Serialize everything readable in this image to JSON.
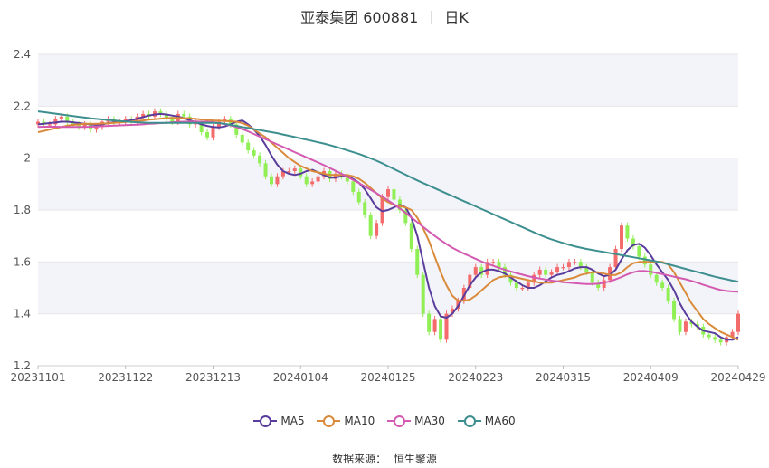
{
  "title": {
    "stock": "亚泰集团 600881",
    "period": "日K"
  },
  "source": {
    "label": "数据来源：",
    "name": "恒生聚源"
  },
  "colors": {
    "up": "#f36b6b",
    "down": "#90ef55",
    "MA5": "#5a3c9c",
    "MA10": "#d98a3a",
    "MA30": "#d35ab0",
    "MA60": "#3d8f8f",
    "band": "#f3f4fa",
    "grid": "#e6e6e6"
  },
  "chart_data": {
    "type": "candlestick",
    "ylim": [
      1.2,
      2.4
    ],
    "yticks": [
      "1.2",
      "1.4",
      "1.6",
      "1.8",
      "2",
      "2.2",
      "2.4"
    ],
    "xtick_labels": [
      "20231101",
      "20231122",
      "20231213",
      "20240104",
      "20240125",
      "20240223",
      "20240315",
      "20240409",
      "20240429"
    ],
    "xtick_index": [
      0,
      15,
      30,
      45,
      60,
      75,
      90,
      105,
      120
    ],
    "close": [
      2.14,
      2.13,
      2.13,
      2.15,
      2.16,
      2.14,
      2.13,
      2.12,
      2.13,
      2.11,
      2.12,
      2.14,
      2.15,
      2.14,
      2.14,
      2.15,
      2.14,
      2.16,
      2.17,
      2.16,
      2.18,
      2.17,
      2.15,
      2.14,
      2.17,
      2.16,
      2.13,
      2.14,
      2.1,
      2.08,
      2.12,
      2.14,
      2.15,
      2.13,
      2.09,
      2.06,
      2.03,
      2.01,
      1.98,
      1.93,
      1.9,
      1.93,
      1.95,
      1.95,
      1.96,
      1.93,
      1.9,
      1.91,
      1.93,
      1.95,
      1.92,
      1.94,
      1.93,
      1.91,
      1.87,
      1.83,
      1.78,
      1.7,
      1.75,
      1.85,
      1.88,
      1.84,
      1.8,
      1.75,
      1.65,
      1.55,
      1.4,
      1.33,
      1.38,
      1.3,
      1.4,
      1.42,
      1.45,
      1.5,
      1.55,
      1.58,
      1.55,
      1.6,
      1.6,
      1.58,
      1.55,
      1.52,
      1.5,
      1.5,
      1.52,
      1.55,
      1.57,
      1.55,
      1.56,
      1.58,
      1.58,
      1.6,
      1.6,
      1.58,
      1.56,
      1.52,
      1.5,
      1.53,
      1.58,
      1.65,
      1.74,
      1.69,
      1.66,
      1.62,
      1.59,
      1.55,
      1.52,
      1.5,
      1.45,
      1.38,
      1.33,
      1.37,
      1.36,
      1.35,
      1.32,
      1.31,
      1.3,
      1.29,
      1.31,
      1.33,
      1.4
    ],
    "series": [
      {
        "name": "MA5",
        "values": [
          2.13,
          2.132,
          2.135,
          2.137,
          2.14,
          2.14,
          2.138,
          2.135,
          2.132,
          2.13,
          2.128,
          2.13,
          2.135,
          2.138,
          2.14,
          2.142,
          2.146,
          2.152,
          2.158,
          2.164,
          2.168,
          2.17,
          2.168,
          2.164,
          2.16,
          2.154,
          2.146,
          2.138,
          2.13,
          2.124,
          2.12,
          2.118,
          2.122,
          2.13,
          2.14,
          2.145,
          2.13,
          2.11,
          2.085,
          2.05,
          2.01,
          1.975,
          1.95,
          1.94,
          1.935,
          1.94,
          1.95,
          1.955,
          1.945,
          1.935,
          1.925,
          1.925,
          1.93,
          1.93,
          1.92,
          1.905,
          1.88,
          1.845,
          1.81,
          1.795,
          1.8,
          1.81,
          1.82,
          1.81,
          1.77,
          1.7,
          1.6,
          1.5,
          1.43,
          1.39,
          1.385,
          1.4,
          1.43,
          1.47,
          1.51,
          1.54,
          1.56,
          1.57,
          1.57,
          1.565,
          1.555,
          1.54,
          1.525,
          1.51,
          1.5,
          1.5,
          1.51,
          1.525,
          1.54,
          1.55,
          1.555,
          1.565,
          1.575,
          1.58,
          1.58,
          1.57,
          1.555,
          1.545,
          1.55,
          1.57,
          1.61,
          1.645,
          1.665,
          1.67,
          1.655,
          1.625,
          1.59,
          1.56,
          1.53,
          1.49,
          1.44,
          1.4,
          1.37,
          1.35,
          1.335,
          1.33,
          1.325,
          1.31,
          1.3,
          1.3,
          1.31
        ]
      },
      {
        "name": "MA10",
        "values": [
          2.1,
          2.105,
          2.11,
          2.115,
          2.12,
          2.125,
          2.128,
          2.13,
          2.132,
          2.132,
          2.132,
          2.133,
          2.134,
          2.136,
          2.137,
          2.139,
          2.141,
          2.143,
          2.145,
          2.148,
          2.15,
          2.152,
          2.154,
          2.155,
          2.155,
          2.154,
          2.153,
          2.151,
          2.149,
          2.147,
          2.145,
          2.144,
          2.143,
          2.142,
          2.14,
          2.135,
          2.125,
          2.11,
          2.095,
          2.08,
          2.06,
          2.04,
          2.02,
          2.0,
          1.985,
          1.97,
          1.96,
          1.95,
          1.945,
          1.94,
          1.935,
          1.935,
          1.935,
          1.935,
          1.93,
          1.92,
          1.905,
          1.885,
          1.865,
          1.845,
          1.83,
          1.82,
          1.815,
          1.81,
          1.8,
          1.77,
          1.73,
          1.68,
          1.62,
          1.56,
          1.51,
          1.47,
          1.45,
          1.45,
          1.455,
          1.47,
          1.49,
          1.51,
          1.53,
          1.54,
          1.545,
          1.545,
          1.54,
          1.535,
          1.53,
          1.525,
          1.52,
          1.52,
          1.52,
          1.525,
          1.53,
          1.535,
          1.54,
          1.55,
          1.555,
          1.56,
          1.56,
          1.555,
          1.55,
          1.55,
          1.56,
          1.58,
          1.595,
          1.6,
          1.6,
          1.6,
          1.6,
          1.6,
          1.59,
          1.56,
          1.52,
          1.48,
          1.44,
          1.41,
          1.38,
          1.36,
          1.345,
          1.33,
          1.32,
          1.31,
          1.3
        ]
      },
      {
        "name": "MA30",
        "values": [
          2.12,
          2.121,
          2.121,
          2.121,
          2.12,
          2.12,
          2.12,
          2.12,
          2.12,
          2.121,
          2.122,
          2.123,
          2.124,
          2.125,
          2.126,
          2.127,
          2.128,
          2.129,
          2.13,
          2.132,
          2.133,
          2.135,
          2.136,
          2.138,
          2.139,
          2.14,
          2.141,
          2.141,
          2.14,
          2.14,
          2.138,
          2.135,
          2.131,
          2.126,
          2.12,
          2.112,
          2.103,
          2.093,
          2.083,
          2.073,
          2.063,
          2.053,
          2.043,
          2.033,
          2.023,
          2.013,
          2.003,
          1.993,
          1.983,
          1.973,
          1.962,
          1.951,
          1.94,
          1.928,
          1.916,
          1.904,
          1.891,
          1.878,
          1.865,
          1.851,
          1.837,
          1.822,
          1.806,
          1.789,
          1.771,
          1.753,
          1.735,
          1.717,
          1.7,
          1.684,
          1.669,
          1.655,
          1.643,
          1.632,
          1.622,
          1.612,
          1.602,
          1.593,
          1.585,
          1.577,
          1.57,
          1.563,
          1.557,
          1.551,
          1.545,
          1.54,
          1.536,
          1.532,
          1.528,
          1.525,
          1.522,
          1.52,
          1.518,
          1.516,
          1.515,
          1.515,
          1.516,
          1.52,
          1.525,
          1.533,
          1.542,
          1.552,
          1.56,
          1.565,
          1.565,
          1.562,
          1.558,
          1.553,
          1.548,
          1.543,
          1.538,
          1.533,
          1.527,
          1.52,
          1.512,
          1.505,
          1.498,
          1.492,
          1.488,
          1.486,
          1.485
        ]
      },
      {
        "name": "MA60",
        "values": [
          2.18,
          2.177,
          2.174,
          2.171,
          2.168,
          2.165,
          2.162,
          2.159,
          2.156,
          2.153,
          2.151,
          2.149,
          2.147,
          2.145,
          2.143,
          2.141,
          2.139,
          2.138,
          2.137,
          2.136,
          2.136,
          2.136,
          2.136,
          2.136,
          2.136,
          2.136,
          2.136,
          2.136,
          2.136,
          2.136,
          2.136,
          2.135,
          2.132,
          2.128,
          2.124,
          2.12,
          2.116,
          2.112,
          2.108,
          2.104,
          2.1,
          2.096,
          2.091,
          2.086,
          2.081,
          2.076,
          2.071,
          2.066,
          2.061,
          2.056,
          2.05,
          2.044,
          2.037,
          2.03,
          2.023,
          2.016,
          2.008,
          1.999,
          1.99,
          1.98,
          1.969,
          1.958,
          1.947,
          1.936,
          1.925,
          1.914,
          1.904,
          1.894,
          1.884,
          1.874,
          1.864,
          1.854,
          1.844,
          1.834,
          1.824,
          1.814,
          1.804,
          1.794,
          1.784,
          1.774,
          1.764,
          1.754,
          1.744,
          1.734,
          1.724,
          1.714,
          1.704,
          1.695,
          1.687,
          1.68,
          1.673,
          1.666,
          1.66,
          1.655,
          1.65,
          1.646,
          1.642,
          1.638,
          1.634,
          1.63,
          1.626,
          1.622,
          1.618,
          1.614,
          1.61,
          1.606,
          1.602,
          1.597,
          1.591,
          1.585,
          1.579,
          1.573,
          1.567,
          1.561,
          1.555,
          1.549,
          1.543,
          1.538,
          1.533,
          1.528,
          1.524
        ]
      }
    ],
    "legend_position": "bottom"
  }
}
